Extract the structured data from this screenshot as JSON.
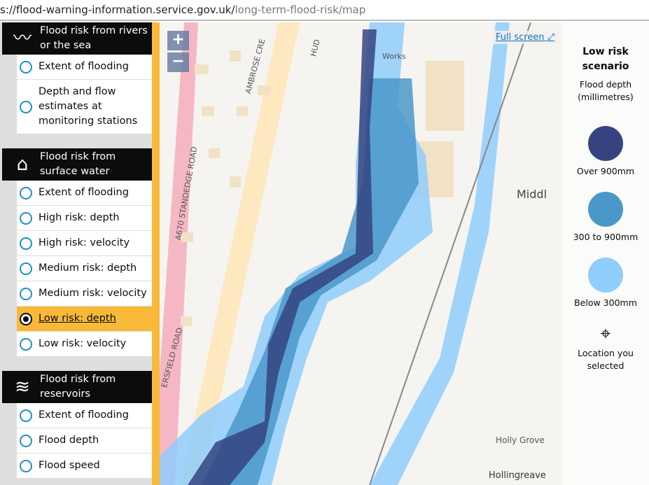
{
  "browser": {
    "url_main": "s://flood-warning-information.service.gov.uk/",
    "url_path": "long-term-flood-risk/map"
  },
  "sections": [
    {
      "title": "Flood risk from rivers or the sea",
      "icon": "river-sea-icon",
      "options": [
        "Extent of flooding",
        "Depth and flow estimates at monitoring stations"
      ]
    },
    {
      "title": "Flood risk from surface water",
      "icon": "surface-water-house-icon",
      "options": [
        "Extent of flooding",
        "High risk: depth",
        "High risk: velocity",
        "Medium risk: depth",
        "Medium risk: velocity",
        "Low risk: depth",
        "Low risk: velocity"
      ]
    },
    {
      "title": "Flood risk from reservoirs",
      "icon": "reservoir-icon",
      "options": [
        "Extent of flooding",
        "Flood depth",
        "Flood speed"
      ]
    }
  ],
  "selected_option": "Low risk: depth",
  "map": {
    "zoom_in": "+",
    "zoom_out": "−",
    "full_screen": "Full screen",
    "labels": {
      "road": "A670  STANDEDGE ROAD",
      "crescent": "AMBROSE CRE",
      "hud": "HUD",
      "road2": "ERSFIELD ROAD",
      "works": "Works",
      "middle": "Middl",
      "holly_grove": "Holly Grove",
      "holly_grove_map": "Holly\nGrove",
      "hollingreave": "Hollingreave"
    }
  },
  "legend": {
    "title": "Low risk scenario",
    "subtitle": "Flood depth (millimetres)",
    "items": [
      {
        "label": "Over 900mm",
        "color": "#354480"
      },
      {
        "label": "300 to 900mm",
        "color": "#4a98ca"
      },
      {
        "label": "Below 300mm",
        "color": "#8fcdfc"
      }
    ],
    "location_label": "Location you selected"
  }
}
